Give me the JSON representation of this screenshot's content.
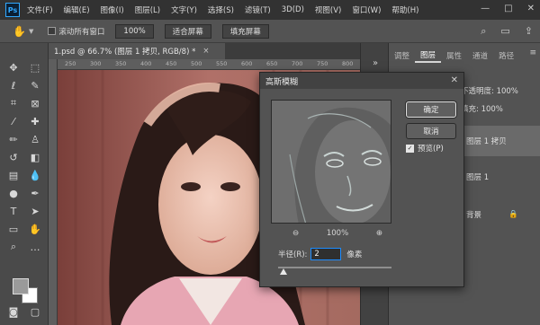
{
  "app": {
    "logo_text": "Ps"
  },
  "menu": [
    "文件(F)",
    "编辑(E)",
    "图像(I)",
    "图层(L)",
    "文字(Y)",
    "选择(S)",
    "滤镜(T)",
    "3D(D)",
    "视图(V)",
    "窗口(W)",
    "帮助(H)"
  ],
  "options": {
    "scroll_all_windows": "滚动所有窗口",
    "zoom_value": "100%",
    "fit_screen": "适合屏幕",
    "fill_screen": "填充屏幕"
  },
  "document": {
    "tab_title": "1.psd @ 66.7% (图层 1 拷贝, RGB/8) *",
    "close_glyph": "×",
    "ruler_labels": [
      "250",
      "300",
      "350",
      "400",
      "450",
      "500",
      "550",
      "600",
      "650",
      "700",
      "750",
      "800"
    ]
  },
  "panels": {
    "tabs": [
      "调整",
      "图层",
      "属性",
      "通道",
      "路径"
    ],
    "active_tab": "图层",
    "layers": [
      {
        "label": "不透明度: 100%"
      },
      {
        "label": "填充: 100%"
      },
      {
        "label": "图层 1 拷贝"
      },
      {
        "label": "图层 1"
      },
      {
        "label": "背景"
      }
    ]
  },
  "dialog": {
    "title": "高斯模糊",
    "ok": "确定",
    "cancel": "取消",
    "preview_label": "预览(P)",
    "preview_checked": true,
    "zoom_percent": "100%",
    "zoom_out": "⊖",
    "zoom_in": "⊕",
    "radius_label": "半径(R):",
    "radius_value": "2",
    "radius_unit": "像素",
    "slider_fraction": 0.02
  },
  "colors": {
    "accent": "#1d8cff",
    "menu_bg": "#323232",
    "panel_bg": "#535353",
    "foreground_swatch": "#9a9a9a",
    "background_swatch": "#ffffff"
  }
}
